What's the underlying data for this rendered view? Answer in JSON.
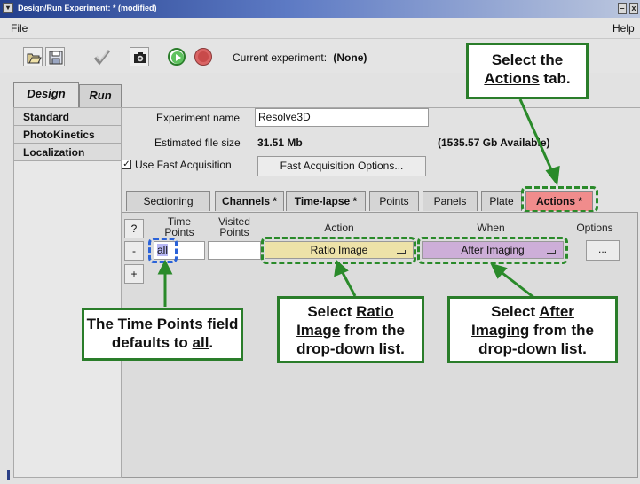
{
  "window": {
    "title": "Design/Run Experiment:  * (modified)",
    "menu_glyph": "▾",
    "min_glyph": "–",
    "close_glyph": "x"
  },
  "menubar": {
    "file": "File",
    "help": "Help"
  },
  "toolbar": {
    "current_experiment_label": "Current experiment:",
    "current_experiment_value": "(None)"
  },
  "main_tabs": [
    "Design",
    "Run"
  ],
  "sidebar": {
    "items": [
      "Standard",
      "PhotoKinetics",
      "Localization"
    ]
  },
  "form": {
    "experiment_name_label": "Experiment name",
    "experiment_name_value": "Resolve3D",
    "file_size_label": "Estimated file size",
    "file_size_value": "31.51 Mb",
    "available": "(1535.57 Gb Available)",
    "fast_acq_label": "Use Fast Acquisition",
    "fast_acq_checked": true,
    "fast_acq_options_label": "Fast Acquisition Options..."
  },
  "subtabs": [
    "Sectioning",
    "Channels *",
    "Time-lapse *",
    "Points",
    "Panels",
    "Plate",
    "Actions *"
  ],
  "table": {
    "help_btn": "?",
    "remove_btn": "-",
    "add_btn": "+",
    "col_time_points_1": "Time",
    "col_time_points_2": "Points",
    "col_visited_1": "Visited",
    "col_visited_2": "Points",
    "col_action": "Action",
    "col_when": "When",
    "col_options": "Options",
    "time_points_value": "all",
    "visited_value": "",
    "action_value": "Ratio Image",
    "when_value": "After Imaging",
    "options_btn": "..."
  },
  "callouts": {
    "actions_tab": {
      "l1": "Select the",
      "l2_u": "Actions",
      "l2": " tab."
    },
    "time_points": {
      "l1": "The Time Points field",
      "l2": "defaults to ",
      "l2_u": "all",
      "l2_end": "."
    },
    "ratio_image": {
      "l1": "Select ",
      "l1_u": "Ratio",
      "l2_u": "Image",
      "l2": " from the",
      "l3": "drop-down list."
    },
    "after_imaging": {
      "l1": "Select ",
      "l1_u": "After",
      "l2_u": "Imaging",
      "l2": " from the",
      "l3": "drop-down list."
    }
  },
  "colors": {
    "callout_green": "#2a7d2a",
    "actions_tab": "#f08c8c",
    "action_dropdown": "#ede2a8",
    "when_dropdown": "#cdaed8",
    "time_field_highlight": "#b8b8f4"
  }
}
